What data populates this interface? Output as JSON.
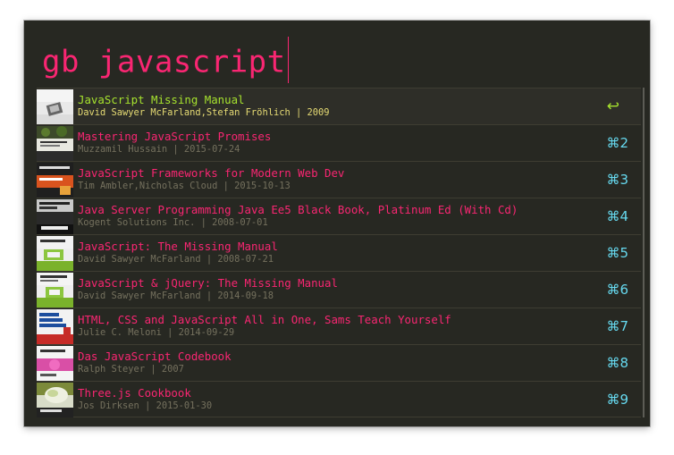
{
  "search": {
    "query": "gb javascript"
  },
  "colors": {
    "background": "#272822",
    "title": "#f92672",
    "subtitle": "#75715e",
    "selected_title": "#a6e22e",
    "selected_subtitle": "#e6db74",
    "shortcut": "#66d9ef"
  },
  "results": [
    {
      "title": "JavaScript Missing Manual",
      "subtitle": "David Sawyer McFarland,Stefan Fröhlich | 2009",
      "shortcut": "↩",
      "cover": "javascript-missing-manual-cover",
      "selected": true
    },
    {
      "title": "Mastering JavaScript Promises",
      "subtitle": "Muzzamil Hussain | 2015-07-24",
      "shortcut": "⌘2",
      "cover": "mastering-promises-cover"
    },
    {
      "title": "JavaScript Frameworks for Modern Web Dev",
      "subtitle": "Tim Ambler,Nicholas Cloud | 2015-10-13",
      "shortcut": "⌘3",
      "cover": "frameworks-cover"
    },
    {
      "title": "Java Server Programming Java Ee5 Black Book, Platinum Ed (With Cd)",
      "subtitle": "Kogent Solutions Inc. | 2008-07-01",
      "shortcut": "⌘4",
      "cover": "black-book-cover"
    },
    {
      "title": "JavaScript: The Missing Manual",
      "subtitle": "David Sawyer McFarland | 2008-07-21",
      "shortcut": "⌘5",
      "cover": "js-missing-manual-cover"
    },
    {
      "title": "JavaScript & jQuery: The Missing Manual",
      "subtitle": "David Sawyer McFarland | 2014-09-18",
      "shortcut": "⌘6",
      "cover": "js-jquery-cover"
    },
    {
      "title": "HTML, CSS and JavaScript All in One, Sams Teach Yourself",
      "subtitle": "Julie C. Meloni | 2014-09-29",
      "shortcut": "⌘7",
      "cover": "html-css-js-cover"
    },
    {
      "title": "Das JavaScript Codebook",
      "subtitle": "Ralph Steyer | 2007",
      "shortcut": "⌘8",
      "cover": "codebook-cover"
    },
    {
      "title": "Three.js Cookbook",
      "subtitle": "Jos Dirksen | 2015-01-30",
      "shortcut": "⌘9",
      "cover": "threejs-cookbook-cover"
    }
  ]
}
